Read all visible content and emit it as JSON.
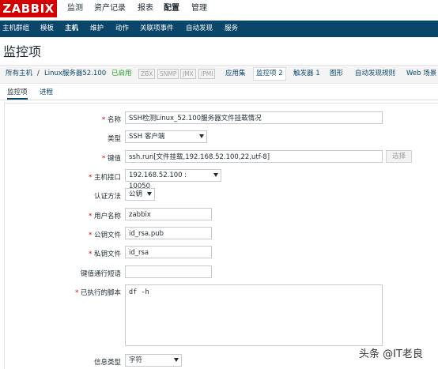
{
  "brand": {
    "logo": "ZABBIX"
  },
  "top_menu": [
    "监测",
    "资产记录",
    "报表",
    "配置",
    "管理"
  ],
  "nav": [
    "主机群组",
    "模板",
    "主机",
    "维护",
    "动作",
    "关联项事件",
    "自动发现",
    "服务"
  ],
  "page_title": "监控项",
  "breadcrumbs": {
    "all_hosts": "所有主机",
    "sep": "/",
    "host": "Linux服务器52.100",
    "status": "已启用",
    "tags": [
      "ZBX",
      "SNMP",
      "JMX",
      "IPMI"
    ],
    "links": [
      "应用集",
      "监控项 2",
      "触发器 1",
      "图形",
      "自动发现规则",
      "Web 场景"
    ]
  },
  "tabs": [
    "监控项",
    "进程"
  ],
  "form": {
    "name": {
      "label": "名称",
      "value": "SSH检测Linux_52.100服务器文件挂载情况"
    },
    "type": {
      "label": "类型",
      "value": "SSH 客户端"
    },
    "key": {
      "label": "键值",
      "value": "ssh.run[文件挂载,192.168.52.100,22,utf-8]",
      "select_button": "选择"
    },
    "interface": {
      "label": "主机接口",
      "value": "192.168.52.100 : 10050"
    },
    "auth": {
      "label": "认证方法",
      "value": "公钥"
    },
    "username": {
      "label": "用户名称",
      "value": "zabbix"
    },
    "public_key": {
      "label": "公钥文件",
      "value": "id_rsa.pub"
    },
    "private_key": {
      "label": "私钥文件",
      "value": "id_rsa"
    },
    "passphrase": {
      "label": "键值通行短语",
      "value": ""
    },
    "script": {
      "label": "已执行的脚本",
      "value": "df -h"
    },
    "info_type": {
      "label": "信息类型",
      "value": "字符"
    }
  },
  "watermark": "头条 @IT老良",
  "colors": {
    "logo_red": "#d40000",
    "nav_blue": "#0a466a",
    "enabled_green": "#2f9f2f"
  }
}
